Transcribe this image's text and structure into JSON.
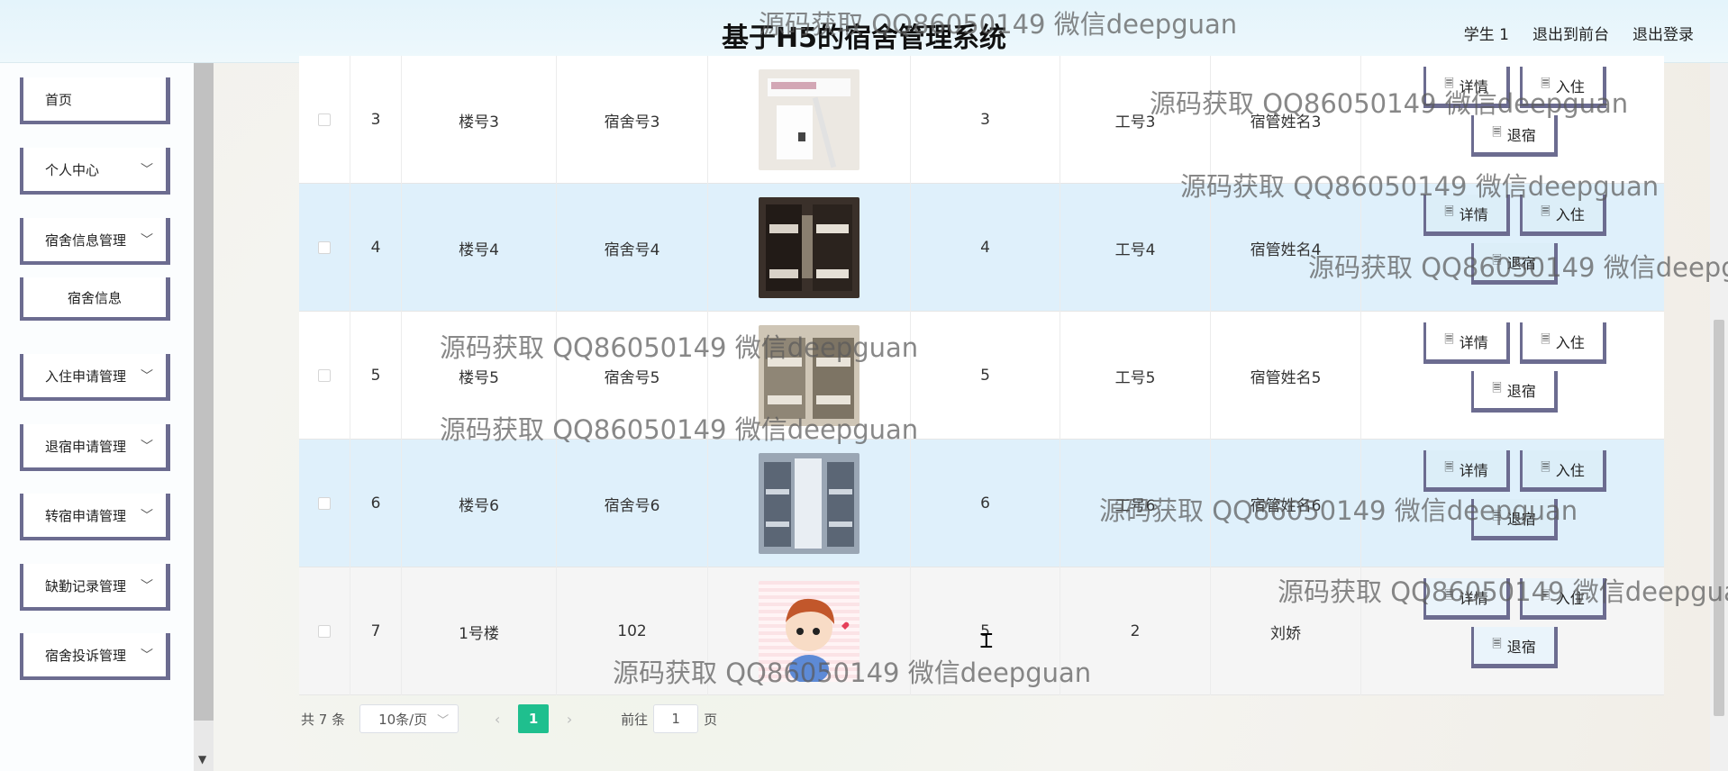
{
  "header": {
    "title": "基于H5的宿舍管理系统",
    "user_label": "学生 1",
    "back_label": "退出到前台",
    "logout_label": "退出登录"
  },
  "sidebar": {
    "items": [
      {
        "label": "首页",
        "expandable": false
      },
      {
        "label": "个人中心",
        "expandable": true
      },
      {
        "label": "宿舍信息管理",
        "expandable": true
      },
      {
        "label": "宿舍信息",
        "expandable": false,
        "sub": true
      },
      {
        "label": "入住申请管理",
        "expandable": true
      },
      {
        "label": "退宿申请管理",
        "expandable": true
      },
      {
        "label": "转宿申请管理",
        "expandable": true
      },
      {
        "label": "缺勤记录管理",
        "expandable": true
      },
      {
        "label": "宿舍投诉管理",
        "expandable": true
      }
    ]
  },
  "table": {
    "rows": [
      {
        "index": "3",
        "building": "楼号3",
        "room": "宿舍号3",
        "beds": "3",
        "staff_no": "工号3",
        "staff_name": "宿管姓名3"
      },
      {
        "index": "4",
        "building": "楼号4",
        "room": "宿舍号4",
        "beds": "4",
        "staff_no": "工号4",
        "staff_name": "宿管姓名4"
      },
      {
        "index": "5",
        "building": "楼号5",
        "room": "宿舍号5",
        "beds": "5",
        "staff_no": "工号5",
        "staff_name": "宿管姓名5"
      },
      {
        "index": "6",
        "building": "楼号6",
        "room": "宿舍号6",
        "beds": "6",
        "staff_no": "工号6",
        "staff_name": "宿管姓名6"
      },
      {
        "index": "7",
        "building": "1号楼",
        "room": "102",
        "beds": "5",
        "staff_no": "2",
        "staff_name": "刘娇"
      }
    ],
    "actions": {
      "detail": "详情",
      "checkin": "入住",
      "checkout": "退宿"
    }
  },
  "pager": {
    "total": "共 7 条",
    "page_size": "10条/页",
    "current_page": "1",
    "goto_prefix": "前往",
    "goto_value": "1",
    "goto_suffix": "页"
  },
  "watermark": "源码获取 QQ86050149 微信deepguan"
}
